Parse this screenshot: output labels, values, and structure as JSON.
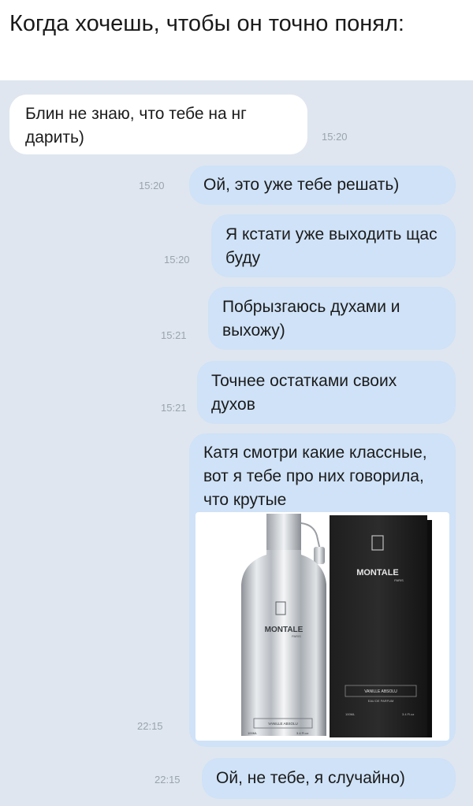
{
  "caption": "Когда хочешь, чтобы он точно понял:",
  "messages": [
    {
      "text": "Блин не знаю, что тебе на нг дарить)",
      "time": "15:20"
    },
    {
      "text": "Ой, это уже тебе решать)",
      "time": "15:20"
    },
    {
      "text": "Я кстати уже выходить щас буду",
      "time": "15:20"
    },
    {
      "text": "Побрызгаюсь духами и выхожу)",
      "time": "15:21"
    },
    {
      "text": "Точнее остатками своих духов",
      "time": "15:21"
    },
    {
      "text": "Катя смотри какие классные, вот я тебе про них говорила, что крутые",
      "time": "22:15"
    },
    {
      "text": "Ой, не тебе, я случайно)",
      "time": "22:15"
    }
  ],
  "product": {
    "brand": "MONTALE",
    "city": "PARIS",
    "name": "VANILLE ABSOLU",
    "type": "EAU DE PARFUM",
    "volume": "100ML",
    "floz": "3.4 Fl.oz"
  },
  "colors": {
    "chat_bg": "#dfe6ef",
    "incoming_bubble": "#ffffff",
    "outgoing_bubble": "#cfe2f7",
    "time_text": "#9aa3ad"
  }
}
